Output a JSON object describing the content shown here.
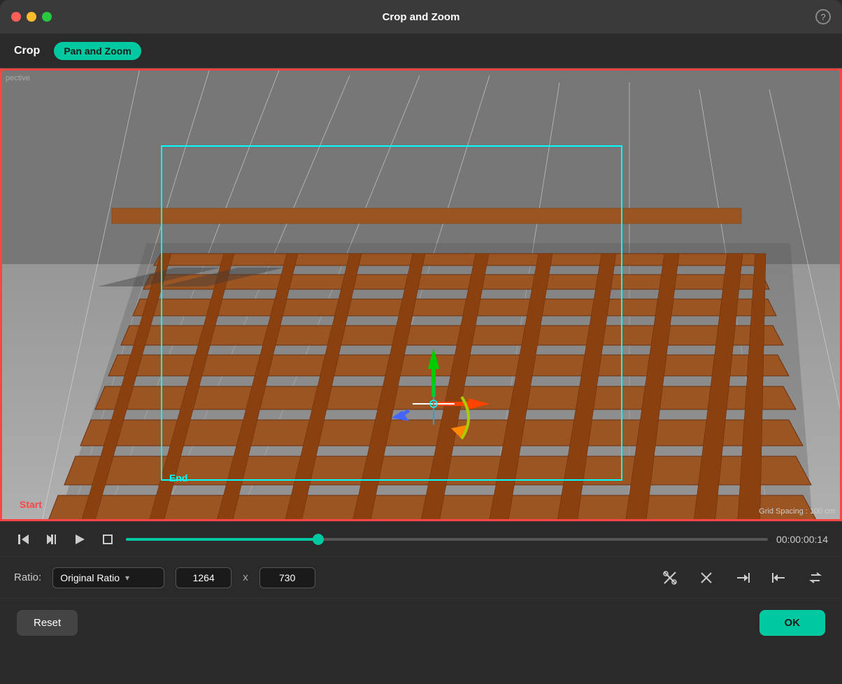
{
  "titlebar": {
    "title": "Crop and Zoom",
    "help_label": "?"
  },
  "toolbar": {
    "tab_crop": "Crop",
    "tab_pan_zoom": "Pan and Zoom"
  },
  "scene": {
    "perspective_label": "pective",
    "end_label": "End",
    "start_label": "Start",
    "grid_spacing": "Grid Spacing : 100 cm"
  },
  "transport": {
    "timecode": "00:00:00:14",
    "timeline_percent": 30
  },
  "ratio": {
    "label": "Ratio:",
    "selected": "Original Ratio",
    "width": "1264",
    "height": "730",
    "x_label": "x"
  },
  "actions": {
    "reset_label": "Reset",
    "ok_label": "OK"
  },
  "icons": {
    "back_step": "⇐",
    "step_forward": "⊳",
    "play": "▷",
    "stop": "□",
    "crop_x": "✂",
    "close_x": "✕",
    "trim_right": "→|",
    "trim_left": "|←",
    "swap": "⇐"
  }
}
